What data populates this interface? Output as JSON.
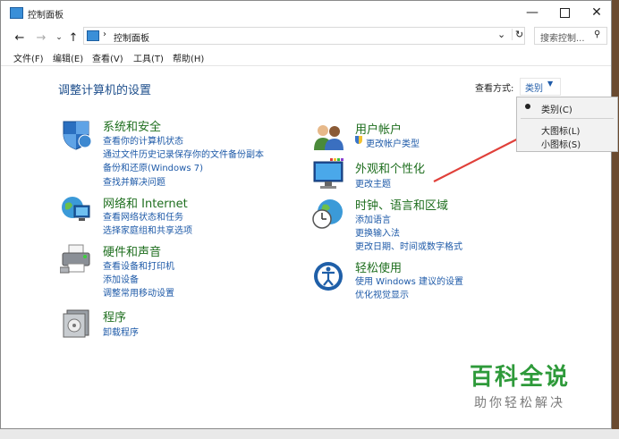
{
  "window": {
    "title": "控制面板"
  },
  "address": {
    "path": "控制面板",
    "search_placeholder": "搜索控制..."
  },
  "menu": [
    "文件(F)",
    "编辑(E)",
    "查看(V)",
    "工具(T)",
    "帮助(H)"
  ],
  "main": {
    "heading": "调整计算机的设置",
    "view_label": "查看方式:",
    "view_value": "类别"
  },
  "dropdown": {
    "items": [
      "类别(C)",
      "大图标(L)",
      "小图标(S)"
    ]
  },
  "categories_left": [
    {
      "title": "系统和安全",
      "links": [
        "查看你的计算机状态",
        "通过文件历史记录保存你的文件备份副本",
        "备份和还原(Windows 7)",
        "查找并解决问题"
      ]
    },
    {
      "title": "网络和 Internet",
      "links": [
        "查看网络状态和任务",
        "选择家庭组和共享选项"
      ]
    },
    {
      "title": "硬件和声音",
      "links": [
        "查看设备和打印机",
        "添加设备",
        "调整常用移动设置"
      ]
    },
    {
      "title": "程序",
      "links": [
        "卸载程序"
      ]
    }
  ],
  "categories_right": [
    {
      "title": "用户帐户",
      "links": [
        "更改帐户类型"
      ]
    },
    {
      "title": "外观和个性化",
      "links": [
        "更改主题"
      ]
    },
    {
      "title": "时钟、语言和区域",
      "links": [
        "添加语言",
        "更换输入法",
        "更改日期、时间或数字格式"
      ]
    },
    {
      "title": "轻松使用",
      "links": [
        "使用 Windows 建议的设置",
        "优化视觉显示"
      ]
    }
  ],
  "watermark": {
    "title": "百科全说",
    "subtitle": "助你轻松解决"
  },
  "colors": {
    "link": "#1e5aa8",
    "category": "#1e6e1e",
    "arrow": "#e0403a",
    "watermark_title": "#2e9a3a"
  }
}
